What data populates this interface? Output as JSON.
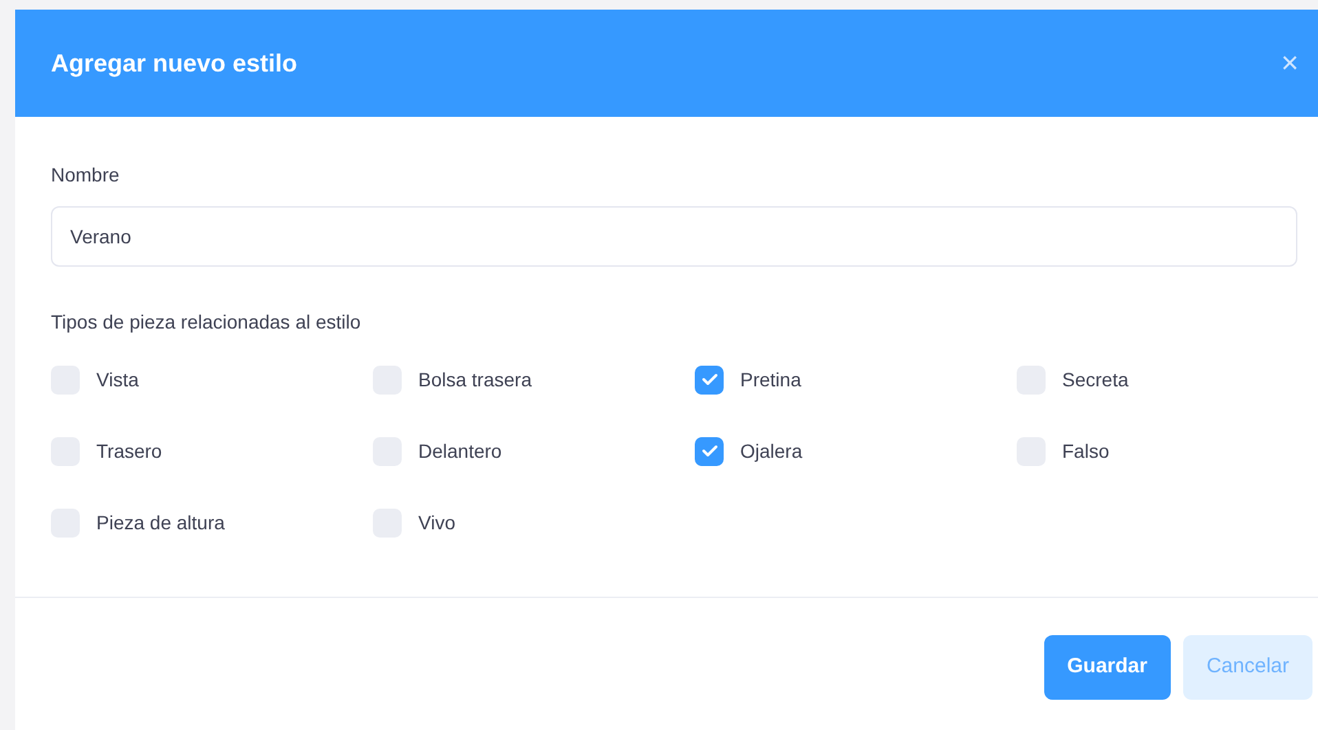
{
  "dialog": {
    "title": "Agregar nuevo estilo",
    "close": "×"
  },
  "name_field": {
    "label": "Nombre",
    "value": "Verano"
  },
  "piece_types": {
    "label": "Tipos de pieza relacionadas al estilo",
    "options": [
      {
        "label": "Vista",
        "checked": false
      },
      {
        "label": "Bolsa trasera",
        "checked": false
      },
      {
        "label": "Pretina",
        "checked": true
      },
      {
        "label": "Secreta",
        "checked": false
      },
      {
        "label": "Trasero",
        "checked": false
      },
      {
        "label": "Delantero",
        "checked": false
      },
      {
        "label": "Ojalera",
        "checked": true
      },
      {
        "label": "Falso",
        "checked": false
      },
      {
        "label": "Pieza de altura",
        "checked": false
      },
      {
        "label": "Vivo",
        "checked": false
      }
    ]
  },
  "buttons": [
    {
      "label": "Guardar",
      "kind": "primary"
    },
    {
      "label": "Cancelar",
      "kind": "secondary"
    }
  ]
}
